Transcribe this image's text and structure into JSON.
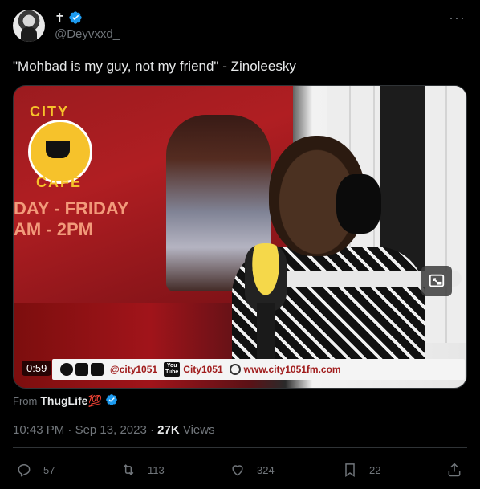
{
  "author": {
    "display_name": "✝",
    "handle": "@Deyvxxd_",
    "verified_color": "#1d9bf0"
  },
  "tweet": {
    "text": "\"Mohbad is my guy, not my friend\" - Zinoleesky"
  },
  "media": {
    "duration": "0:59",
    "logo_top": "CITY",
    "logo_bottom": "CAFE",
    "promo_line1": "DAY - FRIDAY",
    "promo_line2": "AM - 2PM",
    "lower_third": {
      "social_handle": "@city1051",
      "youtube_label_1": "You",
      "youtube_label_2": "Tube",
      "channel": "City1051",
      "website": "www.city1051fm.com"
    },
    "pip_icon": "picture-in-picture-icon"
  },
  "source": {
    "prefix": "From",
    "name": "ThugLife",
    "emoji": "💯"
  },
  "meta": {
    "time": "10:43 PM",
    "separator": "·",
    "date": "Sep 13, 2023",
    "views_count": "27K",
    "views_label": "Views"
  },
  "actions": {
    "replies": "57",
    "reposts": "113",
    "likes": "324",
    "bookmarks": "22"
  },
  "icons": [
    "verified-badge-icon",
    "more-icon",
    "reply-icon",
    "repost-icon",
    "like-icon",
    "bookmark-icon",
    "share-icon"
  ]
}
